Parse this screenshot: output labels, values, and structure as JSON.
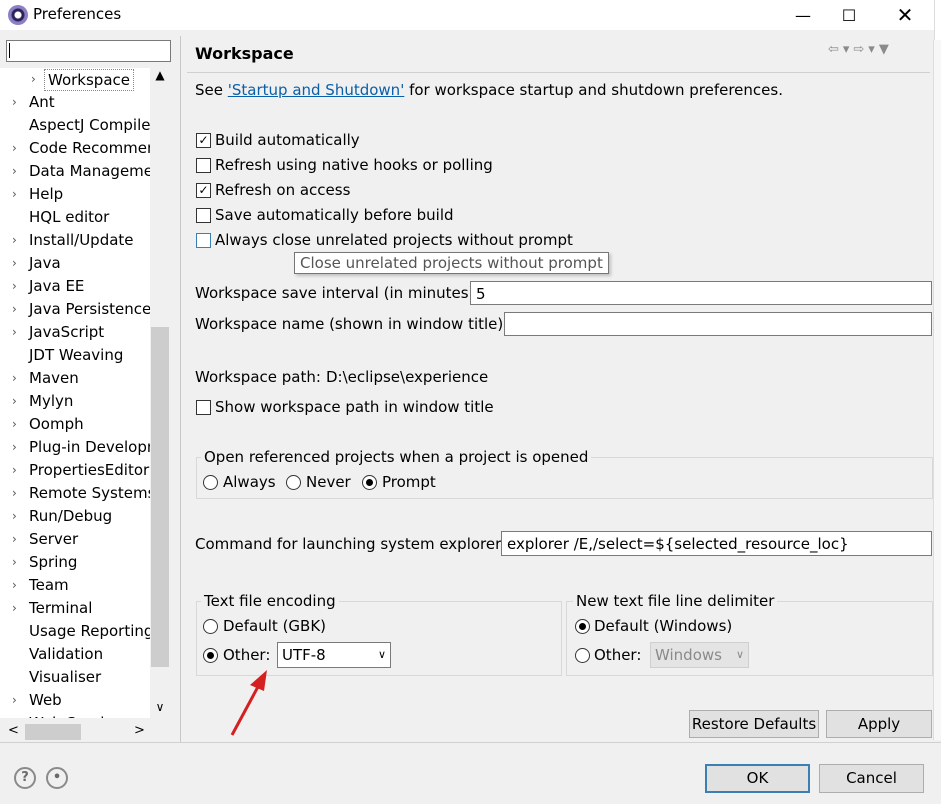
{
  "window": {
    "title": "Preferences",
    "minimize": "—",
    "maximize": "☐",
    "close": "✕"
  },
  "sidebar": {
    "filter_value": "",
    "items": [
      {
        "label": "Workspace",
        "arrow": "›"
      },
      {
        "label": "Ant",
        "arrow": "›"
      },
      {
        "label": "AspectJ Compile",
        "arrow": ""
      },
      {
        "label": "Code Recommen",
        "arrow": "›"
      },
      {
        "label": "Data Manageme",
        "arrow": "›"
      },
      {
        "label": "Help",
        "arrow": "›"
      },
      {
        "label": "HQL editor",
        "arrow": ""
      },
      {
        "label": "Install/Update",
        "arrow": "›"
      },
      {
        "label": "Java",
        "arrow": "›"
      },
      {
        "label": "Java EE",
        "arrow": "›"
      },
      {
        "label": "Java Persistence",
        "arrow": "›"
      },
      {
        "label": "JavaScript",
        "arrow": "›"
      },
      {
        "label": "JDT Weaving",
        "arrow": ""
      },
      {
        "label": "Maven",
        "arrow": "›"
      },
      {
        "label": "Mylyn",
        "arrow": "›"
      },
      {
        "label": "Oomph",
        "arrow": "›"
      },
      {
        "label": "Plug-in Developr",
        "arrow": "›"
      },
      {
        "label": "PropertiesEditor",
        "arrow": "›"
      },
      {
        "label": "Remote Systems",
        "arrow": "›"
      },
      {
        "label": "Run/Debug",
        "arrow": "›"
      },
      {
        "label": "Server",
        "arrow": "›"
      },
      {
        "label": "Spring",
        "arrow": "›"
      },
      {
        "label": "Team",
        "arrow": "›"
      },
      {
        "label": "Terminal",
        "arrow": "›"
      },
      {
        "label": "Usage Reporting",
        "arrow": ""
      },
      {
        "label": "Validation",
        "arrow": ""
      },
      {
        "label": "Visualiser",
        "arrow": ""
      },
      {
        "label": "Web",
        "arrow": "›"
      },
      {
        "label": "Web Services",
        "arrow": "›"
      }
    ],
    "scroll_up": "▲",
    "scroll_down": "∨",
    "scroll_left": "<",
    "scroll_right": ">"
  },
  "page": {
    "title": "Workspace",
    "nav_icons": "⇦▾⇨▾▼",
    "intro_prefix": "See ",
    "intro_link": "'Startup and Shutdown'",
    "intro_suffix": " for workspace startup and shutdown preferences.",
    "checkboxes": [
      {
        "label": "Build automatically",
        "checked": true
      },
      {
        "label": "Refresh using native hooks or polling",
        "checked": false
      },
      {
        "label": "Refresh on access",
        "checked": true
      },
      {
        "label": "Save automatically before build",
        "checked": false
      },
      {
        "label": "Always close unrelated projects without prompt",
        "checked": false
      }
    ],
    "tooltip": "Close unrelated projects without prompt",
    "save_interval_label": "Workspace save interval (in minutes):",
    "save_interval_value": "5",
    "workspace_name_label": "Workspace name (shown in window title):",
    "workspace_name_value": "",
    "workspace_path_label": "Workspace path:",
    "workspace_path_value": "D:\\eclipse\\experience",
    "show_path_label": "Show workspace path in window title",
    "open_ref_group": {
      "title": "Open referenced projects when a project is opened",
      "options": [
        "Always",
        "Never",
        "Prompt"
      ],
      "selected": "Prompt"
    },
    "explorer_cmd_label": "Command for launching system explorer:",
    "explorer_cmd_value": "explorer /E,/select=${selected_resource_loc}",
    "encoding_group": {
      "title": "Text file encoding",
      "default_label": "Default (GBK)",
      "other_label": "Other:",
      "other_value": "UTF-8",
      "selected": "Other"
    },
    "delimiter_group": {
      "title": "New text file line delimiter",
      "default_label": "Default (Windows)",
      "other_label": "Other:",
      "other_value": "Windows",
      "selected": "Default"
    },
    "restore_defaults": "Restore Defaults",
    "apply": "Apply"
  },
  "footer": {
    "help_icon": "?",
    "import_icon": "•",
    "ok": "OK",
    "cancel": "Cancel"
  },
  "annotation": {
    "arrow_color": "#d42020"
  }
}
